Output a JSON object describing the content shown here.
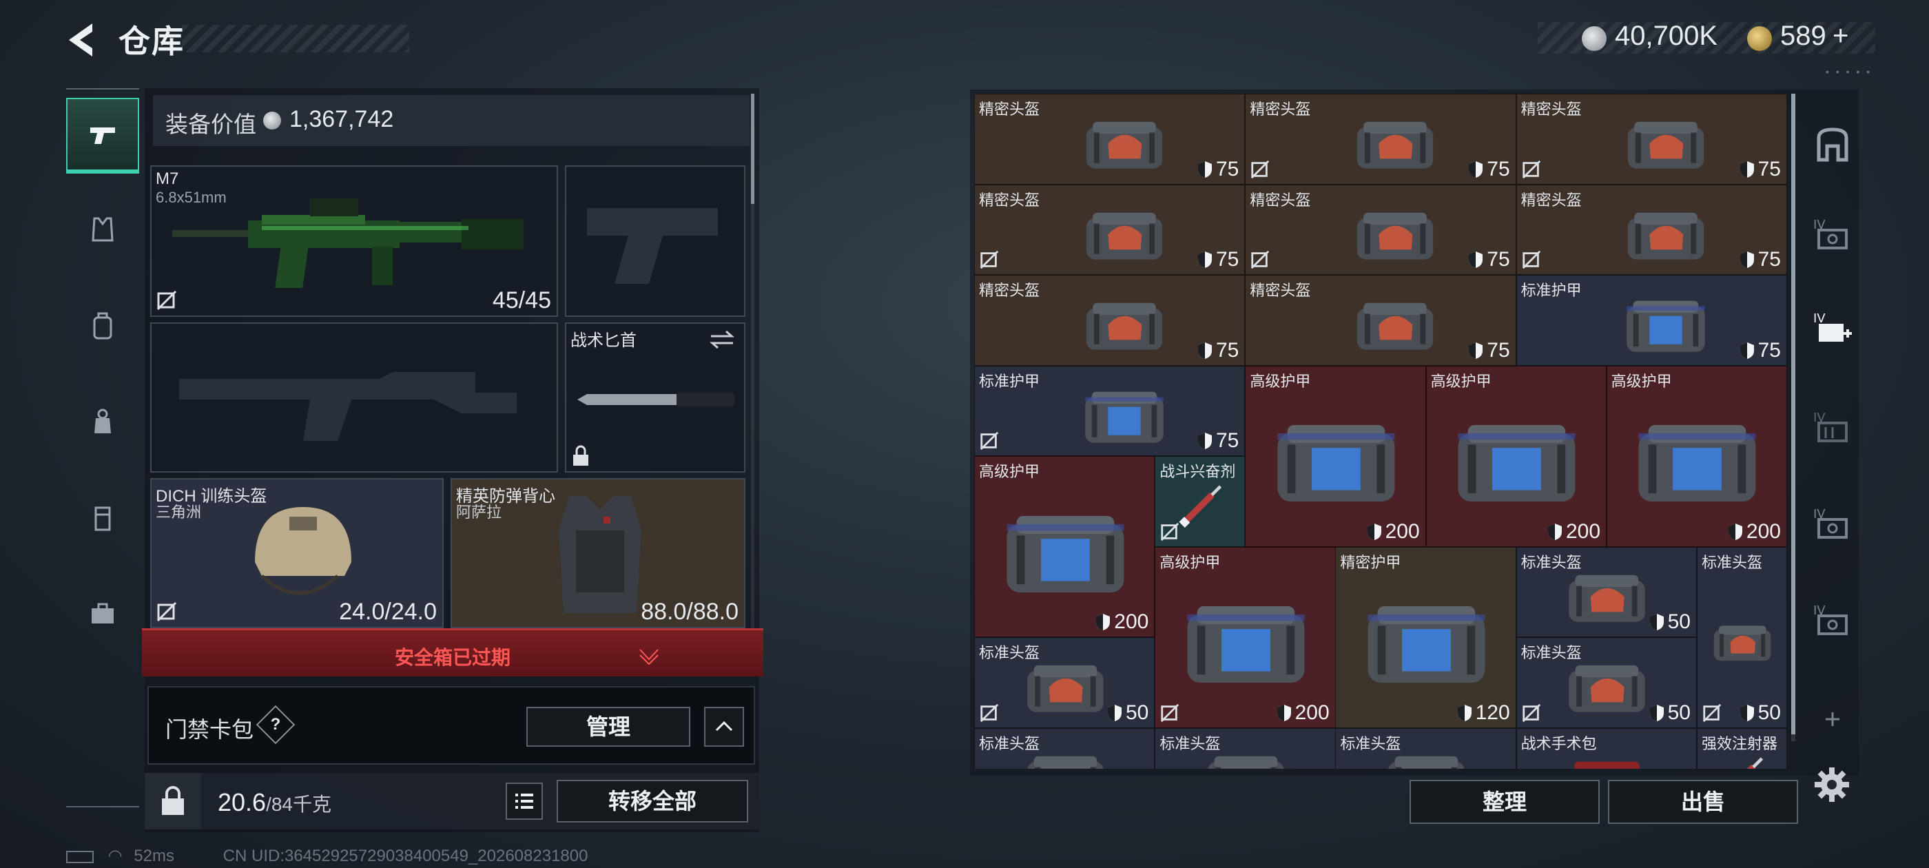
{
  "header": {
    "title": "仓库"
  },
  "currency": {
    "silver": "40,700K",
    "gold": "589",
    "gold_add": "+"
  },
  "equipment": {
    "value_label": "装备价值",
    "value": "1,367,742",
    "primary_weapon": {
      "name": "M7",
      "caliber": "6.8x51mm",
      "ammo": "45/45"
    },
    "knife": {
      "name": "战术匕首"
    },
    "helmet": {
      "name": "DICH 训练头盔",
      "sub": "三角洲",
      "durability": "24.0/24.0"
    },
    "armor": {
      "name": "精英防弹背心",
      "sub": "阿萨拉",
      "durability": "88.0/88.0"
    }
  },
  "safe_box": {
    "status": "安全箱已过期"
  },
  "keycard": {
    "label": "门禁卡包",
    "help": "?",
    "manage_button": "管理"
  },
  "capacity": {
    "current": "20.6",
    "max": "/84千克",
    "transfer_button": "转移全部"
  },
  "status_bar": {
    "ping": "52ms",
    "uid": "CN UID:3645292572903840054​9_202608231800"
  },
  "stash": {
    "items": [
      {
        "name": "精密头盔",
        "value": "75",
        "kind": "helmet",
        "bg": "brown"
      },
      {
        "name": "精密头盔",
        "value": "75",
        "kind": "helmet",
        "bg": "brown"
      },
      {
        "name": "精密头盔",
        "value": "75",
        "kind": "helmet",
        "bg": "brown"
      },
      {
        "name": "精密头盔",
        "value": "75",
        "kind": "helmet",
        "bg": "brown"
      },
      {
        "name": "精密头盔",
        "value": "75",
        "kind": "helmet",
        "bg": "brown"
      },
      {
        "name": "精密头盔",
        "value": "75",
        "kind": "helmet",
        "bg": "brown"
      },
      {
        "name": "精密头盔",
        "value": "75",
        "kind": "helmet",
        "bg": "brown"
      },
      {
        "name": "精密头盔",
        "value": "75",
        "kind": "helmet",
        "bg": "brown"
      },
      {
        "name": "标准护甲",
        "value": "75",
        "kind": "armor",
        "bg": "blue"
      },
      {
        "name": "标准护甲",
        "value": "75",
        "kind": "armor",
        "bg": "blue"
      },
      {
        "name": "高级护甲",
        "value": "200",
        "kind": "armor",
        "bg": "red"
      },
      {
        "name": "高级护甲",
        "value": "200",
        "kind": "armor",
        "bg": "red"
      },
      {
        "name": "高级护甲",
        "value": "200",
        "kind": "armor",
        "bg": "red"
      },
      {
        "name": "高级护甲",
        "value": "200",
        "kind": "armor",
        "bg": "red"
      },
      {
        "name": "战斗兴奋剂",
        "value": "",
        "kind": "syringe",
        "bg": "teal"
      },
      {
        "name": "高级护甲",
        "value": "200",
        "kind": "armor",
        "bg": "red"
      },
      {
        "name": "精密护甲",
        "value": "120",
        "kind": "armor",
        "bg": "tan"
      },
      {
        "name": "标准头盔",
        "value": "50",
        "kind": "helmet",
        "bg": "blue"
      },
      {
        "name": "标准头盔",
        "value": "50",
        "kind": "helmet-tall",
        "bg": "blue"
      },
      {
        "name": "标准头盔",
        "value": "50",
        "kind": "helmet",
        "bg": "blue"
      },
      {
        "name": "标准头盔",
        "value": "50",
        "kind": "helmet",
        "bg": "blue"
      },
      {
        "name": "标准头盔",
        "value": "",
        "kind": "helmet",
        "bg": "blue"
      },
      {
        "name": "标准头盔",
        "value": "",
        "kind": "helmet",
        "bg": "blue"
      },
      {
        "name": "标准头盔",
        "value": "",
        "kind": "helmet",
        "bg": "blue"
      },
      {
        "name": "战术手术包",
        "value": "",
        "kind": "medkit",
        "bg": "blue"
      },
      {
        "name": "强效注射器",
        "value": "",
        "kind": "syringe",
        "bg": "blue"
      }
    ],
    "sort_button": "整理",
    "sell_button": "出售"
  },
  "side_nav": {
    "badge": "IV"
  },
  "colors": {
    "accent": "#3ad0b0",
    "expired": "#ff5656",
    "brown_cell": "#3e3129",
    "blue_cell": "#2a2f40",
    "red_cell": "#4b2126"
  }
}
